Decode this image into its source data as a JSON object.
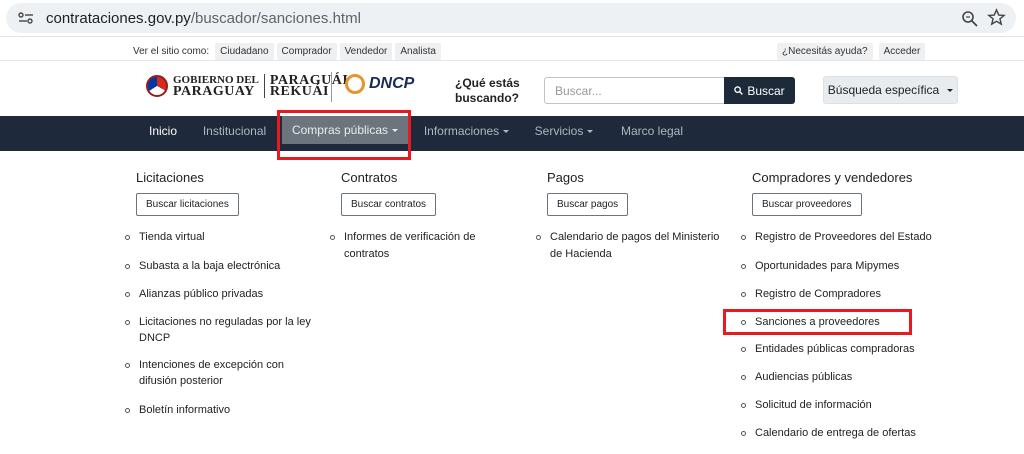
{
  "browser": {
    "url_host": "contrataciones.gov.py",
    "url_path": "/buscador/sanciones.html"
  },
  "utility": {
    "label": "Ver el sitio como:",
    "views": [
      "Ciudadano",
      "Comprador",
      "Vendedor",
      "Analista"
    ],
    "help": "¿Necesitás ayuda?",
    "login": "Acceder"
  },
  "header": {
    "gov_line1": "GOBIERNO DEL",
    "gov_line2": "PARAGUAY",
    "gov_line3": "PARAGUÁI",
    "gov_line4": "REKUÁI",
    "dncp": "DNCP",
    "question_line1": "¿Qué estás",
    "question_line2": "buscando?",
    "search_placeholder": "Buscar...",
    "search_button": "Buscar",
    "advanced_button": "Búsqueda específica"
  },
  "nav": {
    "items": [
      "Inicio",
      "Institucional",
      "Compras públicas",
      "Informaciones",
      "Servicios",
      "Marco legal"
    ]
  },
  "menu": {
    "columns": [
      {
        "title": "Licitaciones",
        "button": "Buscar licitaciones",
        "items": [
          "Tienda virtual",
          "Subasta a la baja electrónica",
          "Alianzas público privadas",
          "Licitaciones no reguladas por la ley",
          "DNCP",
          "Intenciones de excepción con",
          "difusión posterior",
          "Boletín informativo"
        ]
      },
      {
        "title": "Contratos",
        "button": "Buscar contratos",
        "items": [
          "Informes de verificación de",
          "contratos"
        ]
      },
      {
        "title": "Pagos",
        "button": "Buscar pagos",
        "items": [
          "Calendario de pagos del Ministerio",
          "de Hacienda"
        ]
      },
      {
        "title": "Compradores y vendedores",
        "button": "Buscar proveedores",
        "items": [
          "Registro de Proveedores del Estado",
          "Oportunidades para Mipymes",
          "Registro de Compradores",
          "Sanciones a proveedores",
          "Entidades públicas compradoras",
          "Audiencias públicas",
          "Solicitud de información",
          "Calendario de entrega de ofertas"
        ]
      }
    ]
  },
  "colors": {
    "nav_bg": "#1e2a3b",
    "highlight": "#e8191f",
    "search_button_bg": "#1c2a3a"
  }
}
